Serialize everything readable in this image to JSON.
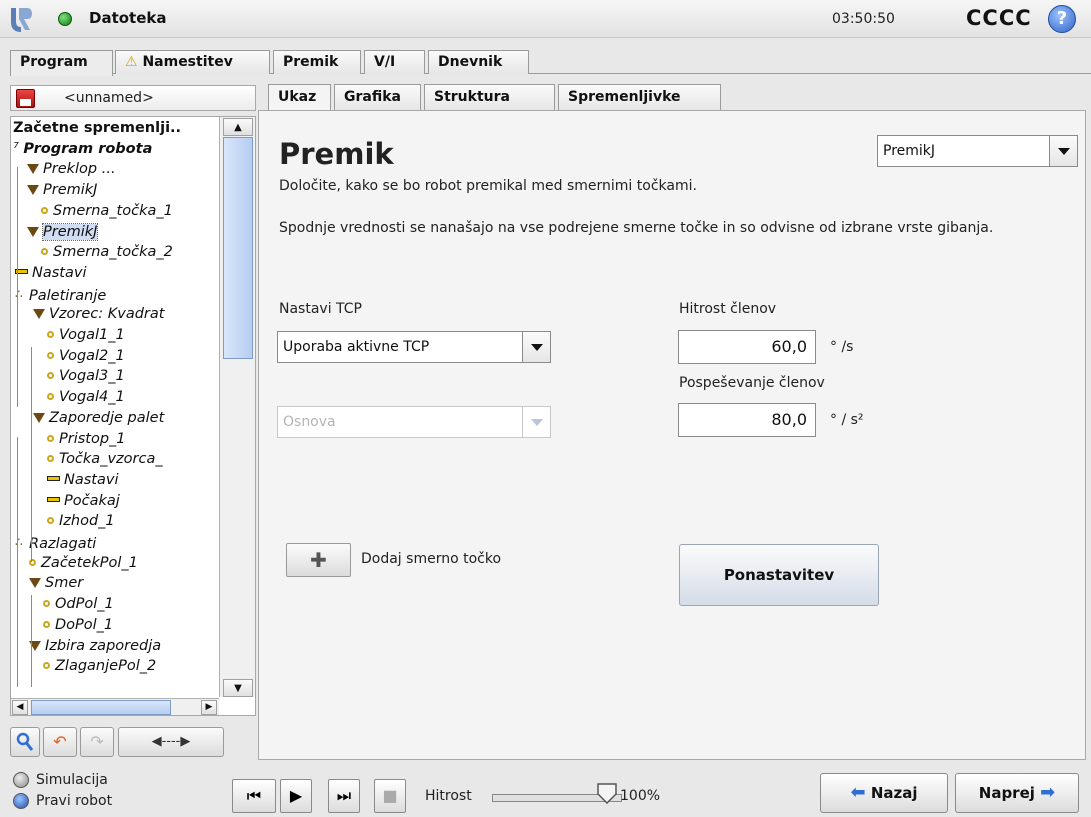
{
  "topbar": {
    "file_label": "Datoteka",
    "clock": "03:50:50",
    "robot_name": "CCCC",
    "help_glyph": "?"
  },
  "main_tabs": [
    {
      "label": "Program",
      "active": true
    },
    {
      "label": "Namestitev",
      "warning": true
    },
    {
      "label": "Premik"
    },
    {
      "label": "V/I"
    },
    {
      "label": "Dnevnik"
    }
  ],
  "left": {
    "program_name": "<unnamed>",
    "tree": [
      {
        "label": "Začetne spremenlji..",
        "kind": "root"
      },
      {
        "label": "Program robota",
        "kind": "prog"
      },
      {
        "label": "Preklop ...",
        "kind": "tri"
      },
      {
        "label": "PremikJ",
        "kind": "tri"
      },
      {
        "label": "Smerna_točka_1",
        "kind": "pt"
      },
      {
        "label": "PremikJ",
        "kind": "tri",
        "selected": true
      },
      {
        "label": "Smerna_točka_2",
        "kind": "pt"
      },
      {
        "label": "Nastavi",
        "kind": "bar"
      },
      {
        "label": "Paletiranje",
        "kind": "dots"
      },
      {
        "label": "Vzorec: Kvadrat",
        "kind": "tri"
      },
      {
        "label": "Vogal1_1",
        "kind": "pt"
      },
      {
        "label": "Vogal2_1",
        "kind": "pt"
      },
      {
        "label": "Vogal3_1",
        "kind": "pt"
      },
      {
        "label": "Vogal4_1",
        "kind": "pt"
      },
      {
        "label": "Zaporedje palet",
        "kind": "tri"
      },
      {
        "label": "Pristop_1",
        "kind": "pt"
      },
      {
        "label": "Točka_vzorca_",
        "kind": "pt"
      },
      {
        "label": "Nastavi",
        "kind": "bar"
      },
      {
        "label": "Počakaj",
        "kind": "bar"
      },
      {
        "label": "Izhod_1",
        "kind": "pt"
      },
      {
        "label": "Razlagati",
        "kind": "dots"
      },
      {
        "label": "ZačetekPol_1",
        "kind": "pt"
      },
      {
        "label": "Smer",
        "kind": "tri"
      },
      {
        "label": "OdPol_1",
        "kind": "pt"
      },
      {
        "label": "DoPol_1",
        "kind": "pt"
      },
      {
        "label": "Izbira zaporedja",
        "kind": "tri"
      },
      {
        "label": "ZlaganjePol_2",
        "kind": "pt"
      }
    ]
  },
  "sub_tabs": [
    {
      "label": "Ukaz",
      "active": true
    },
    {
      "label": "Grafika"
    },
    {
      "label": "Struktura"
    },
    {
      "label": "Spremenljivke"
    }
  ],
  "panel": {
    "title": "Premik",
    "move_type": "PremikJ",
    "subtitle": "Določite, kako se bo robot premikal med smernimi točkami.",
    "description": "Spodnje vrednosti se nanašajo na vse podrejene smerne točke in so odvisne od izbrane vrste gibanja.",
    "tcp_label": "Nastavi TCP",
    "tcp_value": "Uporaba aktivne TCP",
    "feature_value": "Osnova",
    "joint_speed_label": "Hitrost členov",
    "joint_speed_value": "60,0",
    "joint_speed_unit": "° /s",
    "joint_accel_label": "Pospeševanje členov",
    "joint_accel_value": "80,0",
    "joint_accel_unit": "° / s²",
    "add_waypoint_label": "Dodaj smerno točko",
    "reset_label": "Ponastavitev"
  },
  "footer": {
    "simulation_label": "Simulacija",
    "real_robot_label": "Pravi robot",
    "speed_label": "Hitrost",
    "speed_value": "100%",
    "speed_fraction": 1.0,
    "back_label": "Nazaj",
    "next_label": "Naprej"
  }
}
